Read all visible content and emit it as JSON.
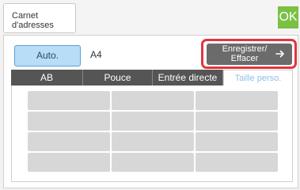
{
  "header": {
    "address_book_line1": "Carnet",
    "address_book_line2": "d'adresses",
    "ok_label": "OK"
  },
  "size": {
    "auto_label": "Auto.",
    "current_value": "A4"
  },
  "register_button": {
    "line1": "Enregistrer/",
    "line2": "Effacer",
    "icon": "arrow-right-icon"
  },
  "tabs": [
    {
      "label": "AB",
      "active": false
    },
    {
      "label": "Pouce",
      "active": false
    },
    {
      "label": "Entrée directe",
      "active": false
    },
    {
      "label": "Taille perso.",
      "active": true
    }
  ],
  "colors": {
    "ok_green": "#7ac143",
    "highlight_red": "#e2343d",
    "auto_blue": "#b8ddf6"
  }
}
